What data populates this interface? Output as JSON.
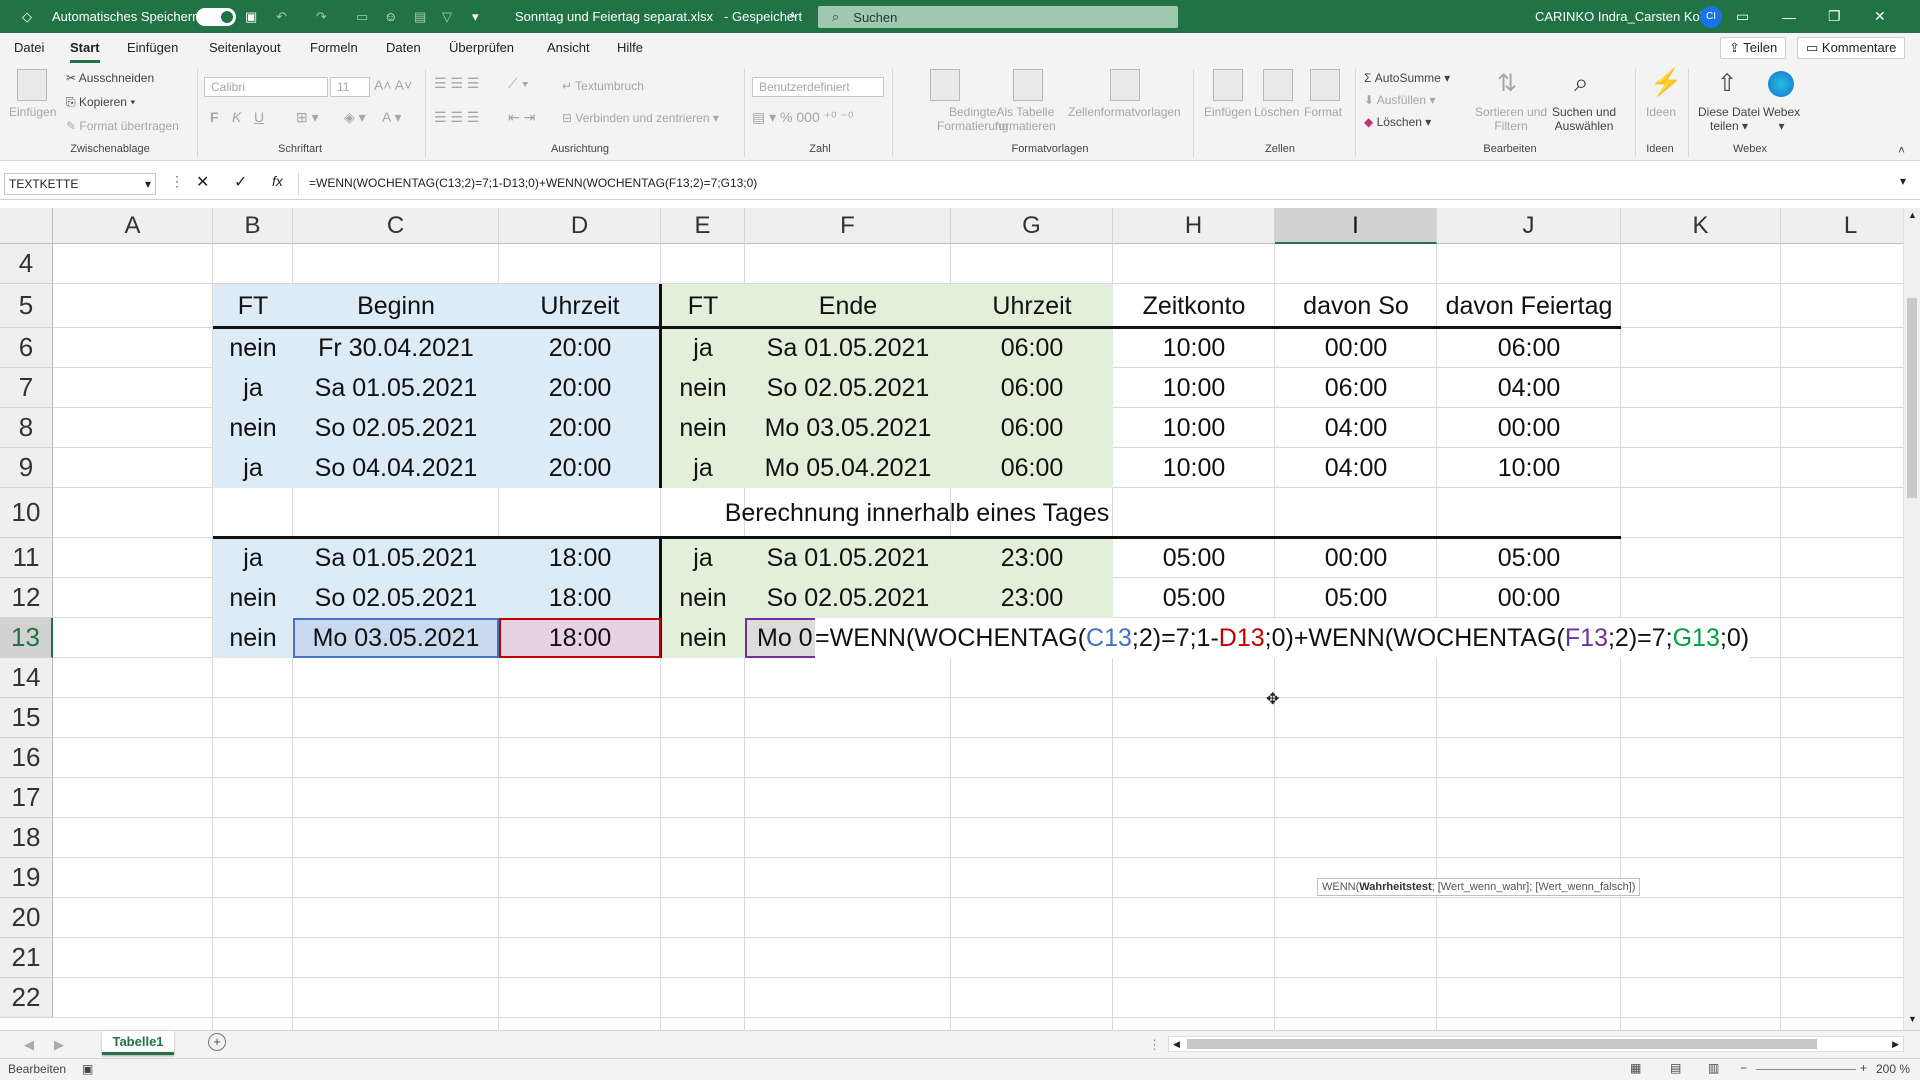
{
  "titlebar": {
    "autosave_label": "Automatisches Speichern",
    "filename": "Sonntag und Feiertag separat.xlsx",
    "save_status": "Gespeichert",
    "search_placeholder": "Suchen",
    "user_name": "CARINKO Indra_Carsten Kohl",
    "user_initials": "CI"
  },
  "menu": {
    "items": [
      "Datei",
      "Start",
      "Einfügen",
      "Seitenlayout",
      "Formeln",
      "Daten",
      "Überprüfen",
      "Ansicht",
      "Hilfe"
    ],
    "active": "Start",
    "share_label": "Teilen",
    "comments_label": "Kommentare"
  },
  "ribbon": {
    "clipboard": {
      "paste": "Einfügen",
      "cut": "Ausschneiden",
      "copy": "Kopieren",
      "format_painter": "Format übertragen",
      "group": "Zwischenablage"
    },
    "font": {
      "name": "Calibri",
      "size": "11",
      "group": "Schriftart",
      "bold": "F",
      "italic": "K",
      "underline": "U"
    },
    "alignment": {
      "wrap": "Textumbruch",
      "merge": "Verbinden und zentrieren",
      "group": "Ausrichtung"
    },
    "number": {
      "format": "Benutzerdefiniert",
      "group": "Zahl"
    },
    "styles": {
      "conditional_1": "Bedingte",
      "conditional_2": "Formatierung",
      "table_1": "Als Tabelle",
      "table_2": "formatieren",
      "cell_styles": "Zellenformatvorlagen",
      "group": "Formatvorlagen"
    },
    "cells": {
      "insert": "Einfügen",
      "delete": "Löschen",
      "format": "Format",
      "group": "Zellen"
    },
    "editing": {
      "autosum": "AutoSumme",
      "fill": "Ausfüllen",
      "clear": "Löschen",
      "sort_1": "Sortieren und",
      "sort_2": "Filtern",
      "find_1": "Suchen und",
      "find_2": "Auswählen",
      "group": "Bearbeiten"
    },
    "ideas": {
      "label": "Ideen",
      "group": "Ideen"
    },
    "webex": {
      "share_1": "Diese Datei",
      "share_2": "teilen",
      "webex": "Webex",
      "group": "Webex"
    }
  },
  "formula_bar": {
    "name_box": "TEXTKETTE",
    "fx": "fx",
    "formula": "=WENN(WOCHENTAG(C13;2)=7;1-D13;0)+WENN(WOCHENTAG(F13;2)=7;G13;0)"
  },
  "grid": {
    "columns": [
      "A",
      "B",
      "C",
      "D",
      "E",
      "F",
      "G",
      "H",
      "I",
      "J",
      "K",
      "L"
    ],
    "selected_column": "I",
    "rows": [
      "4",
      "5",
      "6",
      "7",
      "8",
      "9",
      "10",
      "11",
      "12",
      "13",
      "14",
      "15",
      "16",
      "17",
      "18",
      "19",
      "20",
      "21",
      "22"
    ],
    "selected_row": "13",
    "headers": [
      "FT",
      "Beginn",
      "Uhrzeit",
      "FT",
      "Ende",
      "Uhrzeit",
      "Zeitkonto",
      "davon So",
      "davon Feiertag"
    ],
    "data_rows": [
      [
        "nein",
        "Fr 30.04.2021",
        "20:00",
        "ja",
        "Sa 01.05.2021",
        "06:00",
        "10:00",
        "00:00",
        "06:00"
      ],
      [
        "ja",
        "Sa 01.05.2021",
        "20:00",
        "nein",
        "So 02.05.2021",
        "06:00",
        "10:00",
        "06:00",
        "04:00"
      ],
      [
        "nein",
        "So 02.05.2021",
        "20:00",
        "nein",
        "Mo 03.05.2021",
        "06:00",
        "10:00",
        "04:00",
        "00:00"
      ],
      [
        "ja",
        "So 04.04.2021",
        "20:00",
        "ja",
        "Mo 05.04.2021",
        "06:00",
        "10:00",
        "04:00",
        "10:00"
      ]
    ],
    "section_title": "Berechnung innerhalb eines Tages",
    "day_rows": [
      [
        "ja",
        "Sa 01.05.2021",
        "18:00",
        "ja",
        "Sa 01.05.2021",
        "23:00",
        "05:00",
        "00:00",
        "05:00"
      ],
      [
        "nein",
        "So 02.05.2021",
        "18:00",
        "nein",
        "So 02.05.2021",
        "23:00",
        "05:00",
        "05:00",
        "00:00"
      ]
    ],
    "edit_row": {
      "ft1": "nein",
      "beginn": "Mo 03.05.2021",
      "uhrzeit": "18:00",
      "ft2": "nein",
      "ende_partial": "Mo 0"
    },
    "in_cell_formula": [
      {
        "t": "=WENN(WOCHENTAG(",
        "c": "#111111"
      },
      {
        "t": "C13",
        "c": "#4472c4"
      },
      {
        "t": ";2)=7;1-",
        "c": "#111111"
      },
      {
        "t": "D13",
        "c": "#c00000"
      },
      {
        "t": ";0)+WENN(WOCHENTAG(",
        "c": "#111111"
      },
      {
        "t": "F13",
        "c": "#7030a0"
      },
      {
        "t": ";2)=7;",
        "c": "#111111"
      },
      {
        "t": "G13",
        "c": "#00a040"
      },
      {
        "t": ";0)",
        "c": "#111111"
      }
    ],
    "tooltip": {
      "fn": "WENN(",
      "arg_bold": "Wahrheitstest",
      "rest": "; [Wert_wenn_wahr]; [Wert_wenn_falsch])"
    }
  },
  "sheet_tabs": {
    "active": "Tabelle1",
    "add": "+"
  },
  "status": {
    "mode": "Bearbeiten",
    "zoom": "200 %"
  },
  "colors": {
    "excel_green": "#217346",
    "blue_fill": "#ddebf7",
    "green_fill": "#e2efda"
  }
}
